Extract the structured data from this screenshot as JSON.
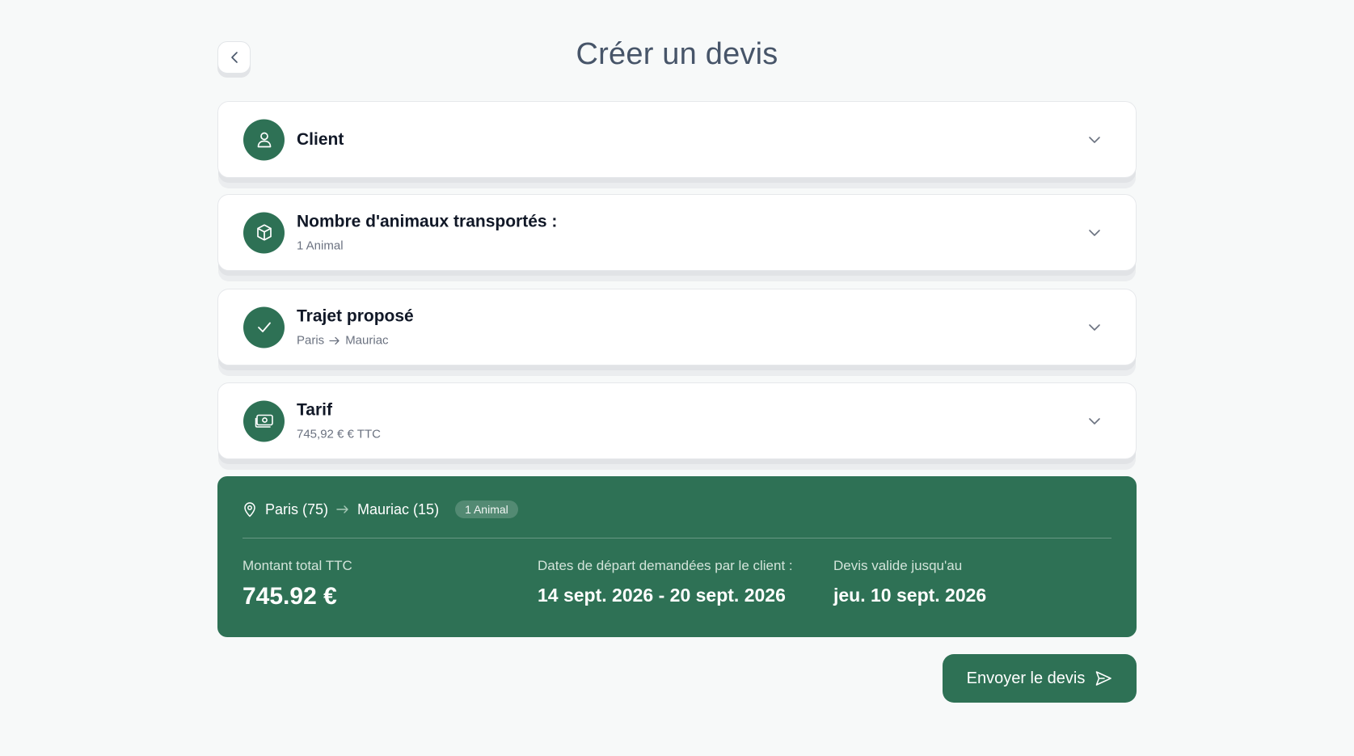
{
  "header": {
    "title": "Créer un devis"
  },
  "sections": [
    {
      "title": "Client",
      "subtitle": "",
      "icon": "user-icon"
    },
    {
      "title": "Nombre d'animaux transportés :",
      "subtitle": "1 Animal",
      "icon": "box-icon"
    },
    {
      "title": "Trajet proposé",
      "from": "Paris",
      "to": "Mauriac",
      "icon": "check-icon"
    },
    {
      "title": "Tarif",
      "subtitle": "745,92 € € TTC",
      "icon": "banknote-icon"
    }
  ],
  "summary": {
    "from": "Paris (75)",
    "to": "Mauriac (15)",
    "badge": "1 Animal",
    "total_label": "Montant total TTC",
    "total_value": "745.92 €",
    "dates_label": "Dates de départ demandées par le client :",
    "dates_value": "14 sept. 2026 - 20 sept. 2026",
    "valid_label": "Devis valide jusqu'au",
    "valid_value": "jeu. 10 sept. 2026"
  },
  "actions": {
    "send_label": "Envoyer le devis"
  },
  "colors": {
    "brand": "#2e7155",
    "background": "#f7f9f9"
  }
}
